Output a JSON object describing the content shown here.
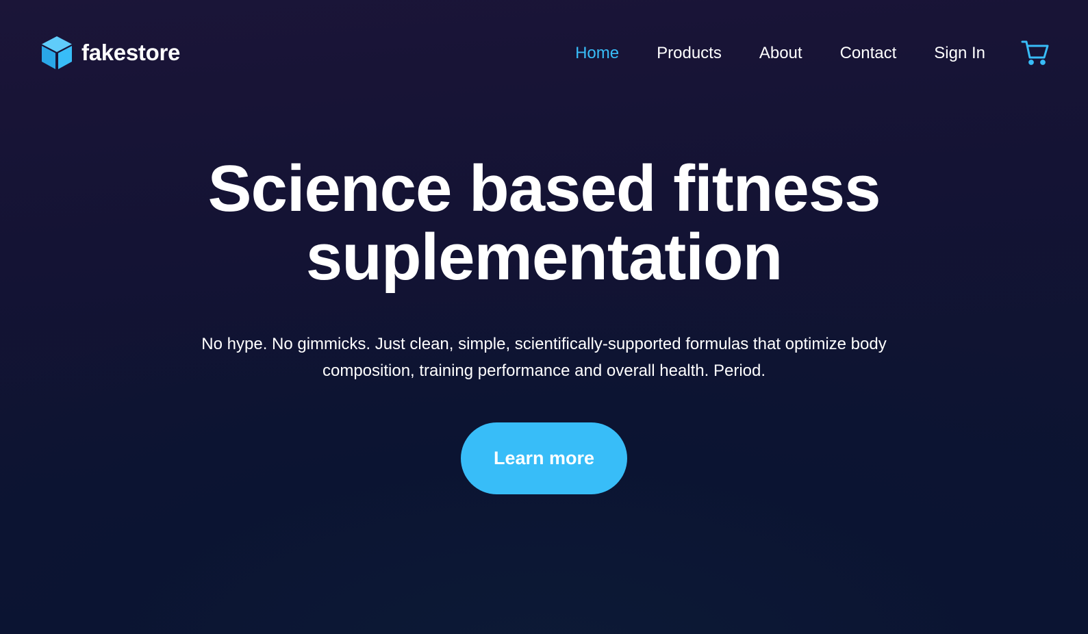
{
  "brand": {
    "name": "fakestore",
    "icon": "cube-icon"
  },
  "nav": {
    "items": [
      {
        "label": "Home",
        "active": true
      },
      {
        "label": "Products",
        "active": false
      },
      {
        "label": "About",
        "active": false
      },
      {
        "label": "Contact",
        "active": false
      },
      {
        "label": "Sign In",
        "active": false
      }
    ],
    "cart_icon": "shopping-cart-icon"
  },
  "hero": {
    "title_line1": "Science based fitness",
    "title_line2": "suplementation",
    "subtitle": "No hype. No gimmicks. Just clean, simple, scientifically-supported formulas that optimize body composition, training performance and overall health. Period.",
    "cta_label": "Learn more"
  },
  "colors": {
    "accent": "#38bdf8",
    "background_top": "#1b1538",
    "background_bottom": "#0b1530",
    "text": "#ffffff"
  }
}
